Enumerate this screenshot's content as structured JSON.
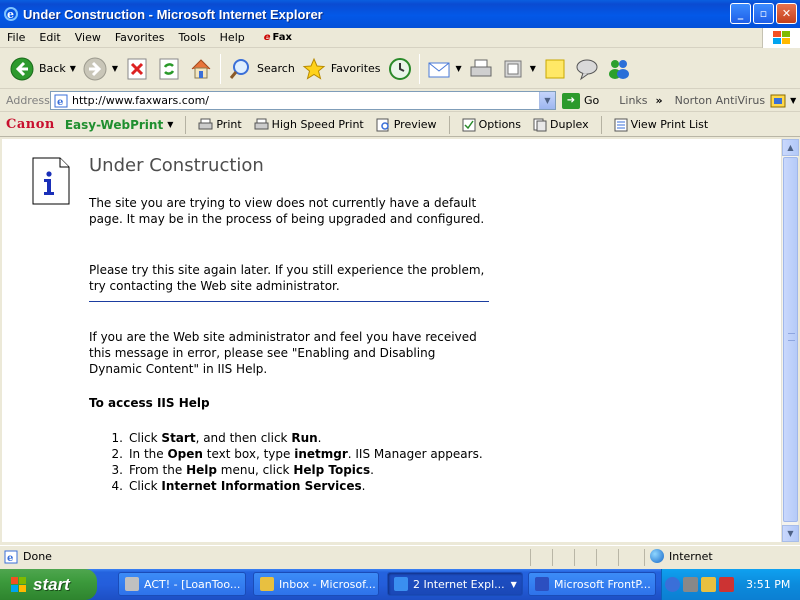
{
  "window": {
    "title": "Under Construction - Microsoft Internet Explorer",
    "minimize": "_",
    "maximize": "▫",
    "close": "✕"
  },
  "menu": {
    "items": [
      "File",
      "Edit",
      "View",
      "Favorites",
      "Tools",
      "Help"
    ],
    "efax_prefix": "e",
    "efax_label": "Fax"
  },
  "toolbar": {
    "back": "Back",
    "search": "Search",
    "favorites": "Favorites"
  },
  "address": {
    "label": "Address",
    "url": "http://www.faxwars.com/",
    "go": "Go",
    "links": "Links",
    "links_chevron": "»",
    "norton": "Norton AntiVirus"
  },
  "canon": {
    "brand": "Canon",
    "product": "Easy-WebPrint",
    "print": "Print",
    "high_speed": "High Speed Print",
    "preview": "Preview",
    "options": "Options",
    "duplex": "Duplex",
    "view_list": "View Print List"
  },
  "page": {
    "title": "Under Construction",
    "para1": "The site you are trying to view does not currently have a default page. It may be in the process of being upgraded and configured.",
    "para2": "Please try this site again later. If you still experience the problem, try contacting the Web site administrator.",
    "para3": "If you are the Web site administrator and feel you have received this message in error, please see \"Enabling and Disabling Dynamic Content\" in IIS Help.",
    "access_heading": "To access IIS Help",
    "steps": [
      {
        "num": "1.",
        "pre": "Click ",
        "b1": "Start",
        "mid": ", and then click ",
        "b2": "Run",
        "post": ".",
        "extra": ""
      },
      {
        "num": "2.",
        "pre": "In the ",
        "b1": "Open",
        "mid": " text box, type ",
        "b2": "inetmgr",
        "post": ". IIS Manager appears.",
        "extra": ""
      },
      {
        "num": "3.",
        "pre": "From the ",
        "b1": "Help",
        "mid": " menu, click ",
        "b2": "Help Topics",
        "post": ".",
        "extra": ""
      },
      {
        "num": "4.",
        "pre": "Click ",
        "b1": "Internet Information Services",
        "mid": ".",
        "b2": "",
        "post": "",
        "extra": ""
      }
    ]
  },
  "status": {
    "text": "Done",
    "zone": "Internet"
  },
  "taskbar": {
    "start": "start",
    "tasks": [
      {
        "label": "ACT! - [LoanToo..."
      },
      {
        "label": "Inbox - Microsof..."
      },
      {
        "label": "2 Internet Expl..."
      },
      {
        "label": "Microsoft FrontP..."
      }
    ],
    "clock": "3:51 PM"
  },
  "colors": {
    "titlebar": "#0358e8",
    "start_green": "#3c9a3c",
    "canon_red": "#c8102e",
    "easyweb_green": "#1f8f2f"
  }
}
